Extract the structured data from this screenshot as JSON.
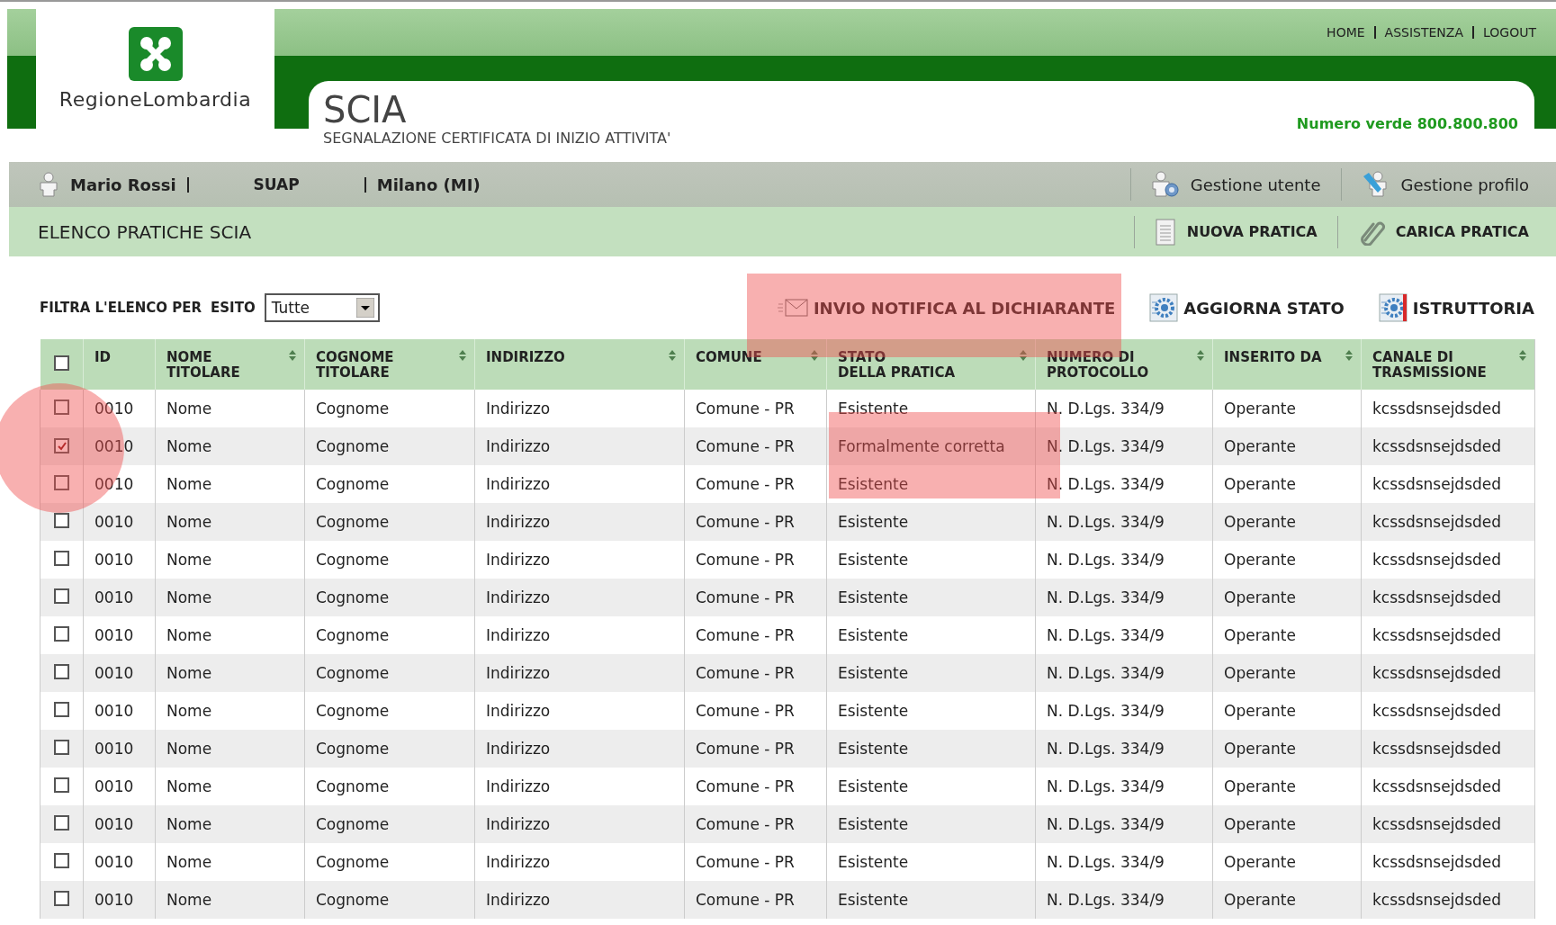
{
  "header": {
    "logo_text": "RegioneLombardia",
    "top_links": [
      "HOME",
      "ASSISTENZA",
      "LOGOUT"
    ],
    "title": "SCIA",
    "subtitle": "SEGNALAZIONE CERTIFICATA DI INIZIO ATTIVITA'",
    "hotline": "Numero verde 800.800.800"
  },
  "user_bar": {
    "user": "Mario Rossi",
    "office": "SUAP",
    "city": "Milano (MI)",
    "actions": [
      {
        "label": "Gestione utente",
        "kind": "user"
      },
      {
        "label": "Gestione profilo",
        "kind": "profile"
      }
    ]
  },
  "title_bar": {
    "title": "ELENCO PRATICHE SCIA",
    "actions": [
      {
        "label": "NUOVA PRATICA",
        "kind": "document"
      },
      {
        "label": "CARICA PRATICA",
        "kind": "attach"
      }
    ]
  },
  "filter": {
    "label": "FILTRA L'ELENCO PER",
    "field_label": "ESITO",
    "value": "Tutte"
  },
  "toolbar": [
    {
      "label": "INVIO NOTIFICA AL DICHIARANTE",
      "kind": "mail"
    },
    {
      "label": "AGGIORNA STATO",
      "kind": "gear"
    },
    {
      "label": "ISTRUTTORIA",
      "kind": "gear-red"
    }
  ],
  "table": {
    "all_checked": false,
    "columns": [
      {
        "label": "ID",
        "sortable": false
      },
      {
        "label": "NOME\nTITOLARE",
        "sortable": true
      },
      {
        "label": "COGNOME\nTITOLARE",
        "sortable": true
      },
      {
        "label": "INDIRIZZO",
        "sortable": true
      },
      {
        "label": "COMUNE",
        "sortable": true
      },
      {
        "label": "STATO\nDELLA PRATICA",
        "sortable": true
      },
      {
        "label": "NUMERO DI\nPROTOCOLLO",
        "sortable": true
      },
      {
        "label": "INSERITO DA",
        "sortable": true
      },
      {
        "label": "CANALE DI\nTRASMISSIONE",
        "sortable": true
      }
    ],
    "rows": [
      {
        "selected": false,
        "cells": [
          "0010",
          "Nome",
          "Cognome",
          "Indirizzo",
          "Comune - PR",
          "Esistente",
          "N. D.Lgs. 334/9",
          "Operante",
          "kcssdsnsejdsded"
        ]
      },
      {
        "selected": true,
        "cells": [
          "0010",
          "Nome",
          "Cognome",
          "Indirizzo",
          "Comune - PR",
          "Formalmente corretta",
          "N. D.Lgs. 334/9",
          "Operante",
          "kcssdsnsejdsded"
        ]
      },
      {
        "selected": false,
        "cells": [
          "0010",
          "Nome",
          "Cognome",
          "Indirizzo",
          "Comune - PR",
          "Esistente",
          "N. D.Lgs. 334/9",
          "Operante",
          "kcssdsnsejdsded"
        ]
      },
      {
        "selected": false,
        "cells": [
          "0010",
          "Nome",
          "Cognome",
          "Indirizzo",
          "Comune - PR",
          "Esistente",
          "N. D.Lgs. 334/9",
          "Operante",
          "kcssdsnsejdsded"
        ]
      },
      {
        "selected": false,
        "cells": [
          "0010",
          "Nome",
          "Cognome",
          "Indirizzo",
          "Comune - PR",
          "Esistente",
          "N. D.Lgs. 334/9",
          "Operante",
          "kcssdsnsejdsded"
        ]
      },
      {
        "selected": false,
        "cells": [
          "0010",
          "Nome",
          "Cognome",
          "Indirizzo",
          "Comune - PR",
          "Esistente",
          "N. D.Lgs. 334/9",
          "Operante",
          "kcssdsnsejdsded"
        ]
      },
      {
        "selected": false,
        "cells": [
          "0010",
          "Nome",
          "Cognome",
          "Indirizzo",
          "Comune - PR",
          "Esistente",
          "N. D.Lgs. 334/9",
          "Operante",
          "kcssdsnsejdsded"
        ]
      },
      {
        "selected": false,
        "cells": [
          "0010",
          "Nome",
          "Cognome",
          "Indirizzo",
          "Comune - PR",
          "Esistente",
          "N. D.Lgs. 334/9",
          "Operante",
          "kcssdsnsejdsded"
        ]
      },
      {
        "selected": false,
        "cells": [
          "0010",
          "Nome",
          "Cognome",
          "Indirizzo",
          "Comune - PR",
          "Esistente",
          "N. D.Lgs. 334/9",
          "Operante",
          "kcssdsnsejdsded"
        ]
      },
      {
        "selected": false,
        "cells": [
          "0010",
          "Nome",
          "Cognome",
          "Indirizzo",
          "Comune - PR",
          "Esistente",
          "N. D.Lgs. 334/9",
          "Operante",
          "kcssdsnsejdsded"
        ]
      },
      {
        "selected": false,
        "cells": [
          "0010",
          "Nome",
          "Cognome",
          "Indirizzo",
          "Comune - PR",
          "Esistente",
          "N. D.Lgs. 334/9",
          "Operante",
          "kcssdsnsejdsded"
        ]
      },
      {
        "selected": false,
        "cells": [
          "0010",
          "Nome",
          "Cognome",
          "Indirizzo",
          "Comune - PR",
          "Esistente",
          "N. D.Lgs. 334/9",
          "Operante",
          "kcssdsnsejdsded"
        ]
      },
      {
        "selected": false,
        "cells": [
          "0010",
          "Nome",
          "Cognome",
          "Indirizzo",
          "Comune - PR",
          "Esistente",
          "N. D.Lgs. 334/9",
          "Operante",
          "kcssdsnsejdsded"
        ]
      },
      {
        "selected": false,
        "cells": [
          "0010",
          "Nome",
          "Cognome",
          "Indirizzo",
          "Comune - PR",
          "Esistente",
          "N. D.Lgs. 334/9",
          "Operante",
          "kcssdsnsejdsded"
        ]
      }
    ]
  }
}
